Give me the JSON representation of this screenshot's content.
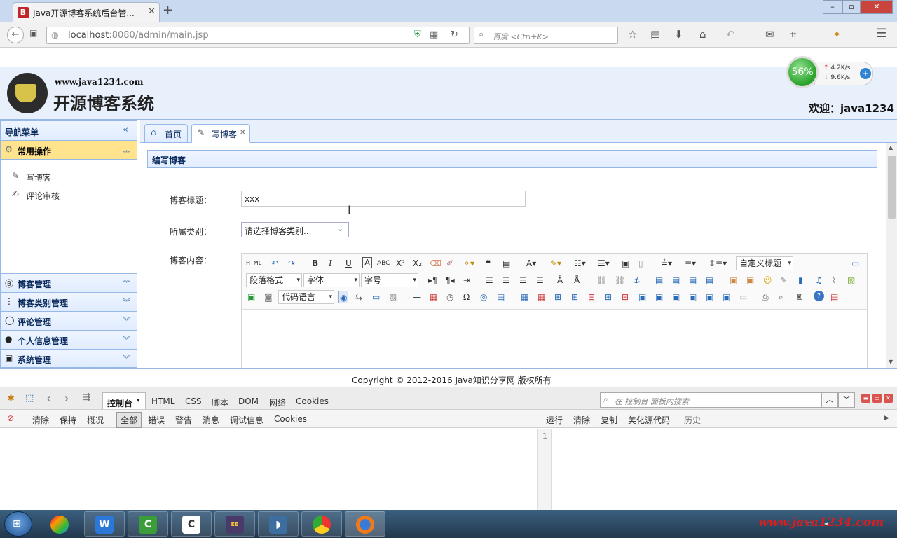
{
  "browser": {
    "tab_title": "Java开源博客系统后台管...",
    "tab_favicon": "B",
    "url_host": "localhost",
    "url_rest": ":8080/admin/main.jsp",
    "search_placeholder": "百度 <Ctrl+K>"
  },
  "header": {
    "site_url": "www.java1234.com",
    "site_name": "开源博客系统",
    "welcome": "欢迎：java1234"
  },
  "net_widget": {
    "percent": "56%",
    "up": "4.2K/s",
    "down": "9.6K/s"
  },
  "sidebar": {
    "title": "导航菜单",
    "active_group": "常用操作",
    "items": [
      "写博客",
      "评论审核"
    ],
    "groups": [
      "博客管理",
      "博客类别管理",
      "评论管理",
      "个人信息管理",
      "系统管理"
    ]
  },
  "tabs": [
    {
      "label": "首页"
    },
    {
      "label": "写博客"
    }
  ],
  "form": {
    "panel_title": "编写博客",
    "title_label": "博客标题：",
    "title_value": "xxx",
    "category_label": "所属类别：",
    "category_value": "请选择博客类别...",
    "content_label": "博客内容："
  },
  "editor": {
    "html_btn": "HTML",
    "custom_title": "自定义标题",
    "paragraph": "段落格式",
    "font": "字体",
    "size": "字号",
    "code_lang": "代码语言"
  },
  "footer": "Copyright © 2012-2016 Java知识分享网 版权所有",
  "devtools": {
    "tabs": [
      "控制台",
      "HTML",
      "CSS",
      "脚本",
      "DOM",
      "网络",
      "Cookies"
    ],
    "search_placeholder": "在 控制台 面板内搜索",
    "left_tools": [
      "清除",
      "保持",
      "概况",
      "全部",
      "错误",
      "警告",
      "消息",
      "调试信息",
      "Cookies"
    ],
    "right_tools": [
      "运行",
      "清除",
      "复制",
      "美化源代码",
      "历史"
    ],
    "line_number": "1"
  },
  "watermark": "www.java1234.com"
}
